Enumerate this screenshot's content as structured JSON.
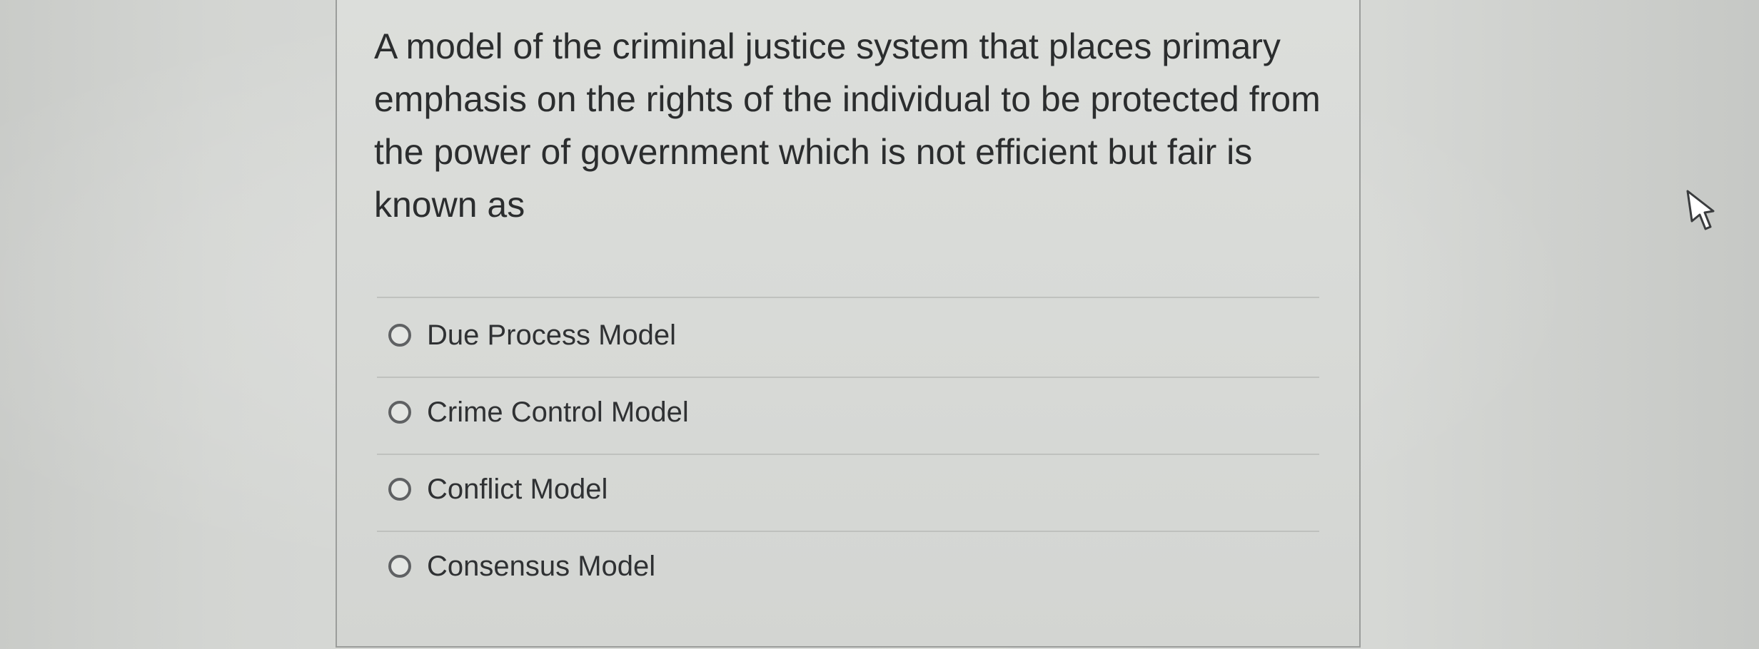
{
  "question": {
    "text": "A model of the criminal justice system that places primary emphasis on the rights of the individual to be protected from the power of government which is not efficient but fair is known as"
  },
  "options": [
    {
      "label": "Due Process Model",
      "selected": false
    },
    {
      "label": "Crime Control Model",
      "selected": false
    },
    {
      "label": "Conflict Model",
      "selected": false
    },
    {
      "label": "Consensus Model",
      "selected": false
    }
  ],
  "cursor": {
    "icon": "hand-pointer-icon"
  }
}
